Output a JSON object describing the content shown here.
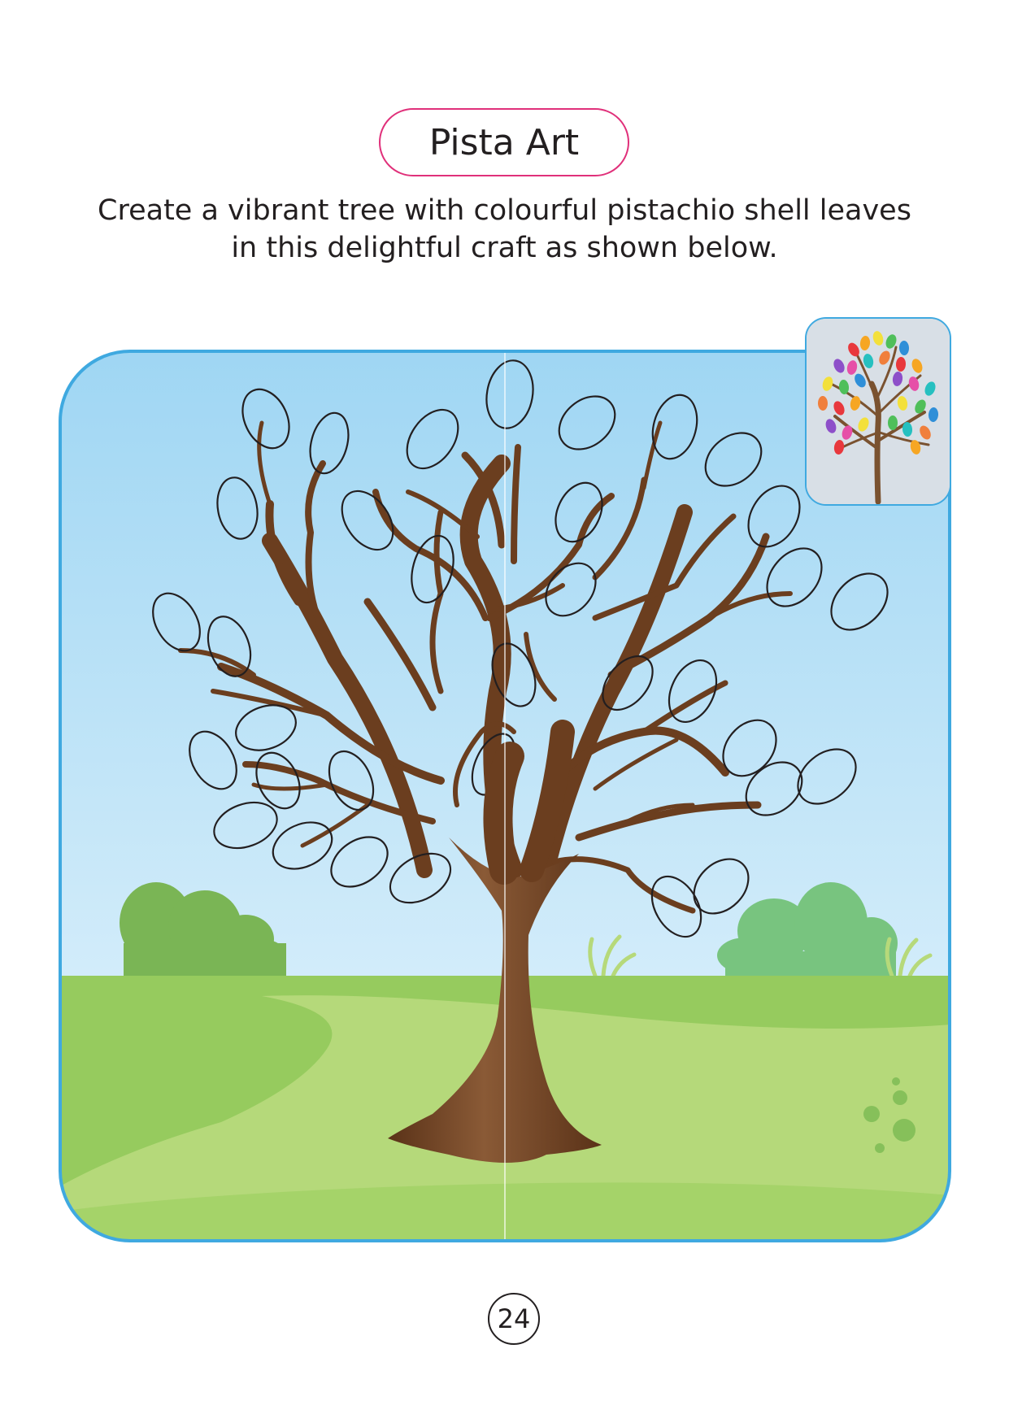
{
  "page": {
    "title": "Pista Art",
    "instructions": [
      "Create a vibrant tree with colourful pistachio shell leaves",
      "in this delightful craft as shown below."
    ],
    "page_number": "24"
  },
  "scene": {
    "sky_color_top": "#9fd6f3",
    "sky_color_bottom": "#d2ecfa",
    "grass_color": "#96cb5e",
    "path_color": "#b5d97a",
    "trunk_color": "#6b3e1f",
    "frame_border_color": "#3fa9e0",
    "title_border_color": "#e0307a"
  },
  "reference_photo": {
    "leaf_colors": [
      "#e8383d",
      "#f6a623",
      "#f3e03b",
      "#4fbf5a",
      "#2f8fd8",
      "#8d4fc9",
      "#e64fa8",
      "#26c0c0",
      "#f07f3c"
    ]
  }
}
